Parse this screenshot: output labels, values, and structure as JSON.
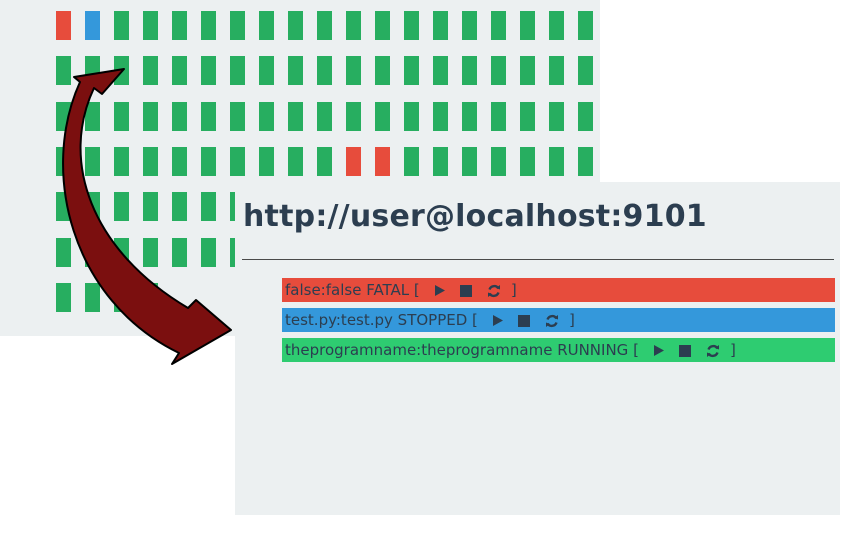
{
  "colors": {
    "fatal": "#e74c3c",
    "stopped": "#3498db",
    "running": "#27ae60",
    "running_row": "#2ecc71",
    "panel_bg": "#ecf0f1",
    "text_dark": "#2c3e50",
    "arrow": "#7b0f0f"
  },
  "grid": {
    "rows": 7,
    "cols": 19,
    "status_cells": [
      {
        "row": 0,
        "col": 0,
        "status": "fatal"
      },
      {
        "row": 0,
        "col": 1,
        "status": "stopped"
      },
      {
        "row": 3,
        "col": 10,
        "status": "fatal"
      },
      {
        "row": 3,
        "col": 11,
        "status": "fatal"
      }
    ],
    "default_status": "running",
    "partial_rows": [
      {
        "row": 6,
        "visible_cols": 4
      }
    ]
  },
  "detail": {
    "host_title": "http://user@localhost:9101",
    "processes": [
      {
        "label": "false:false FATAL [",
        "status": "fatal",
        "close": "]"
      },
      {
        "label": "test.py:test.py STOPPED [",
        "status": "stopped",
        "close": "]"
      },
      {
        "label": "theprogramname:theprogramname RUNNING [",
        "status": "running",
        "close": "]"
      }
    ],
    "controls": [
      "play-icon",
      "stop-icon",
      "refresh-icon"
    ]
  }
}
